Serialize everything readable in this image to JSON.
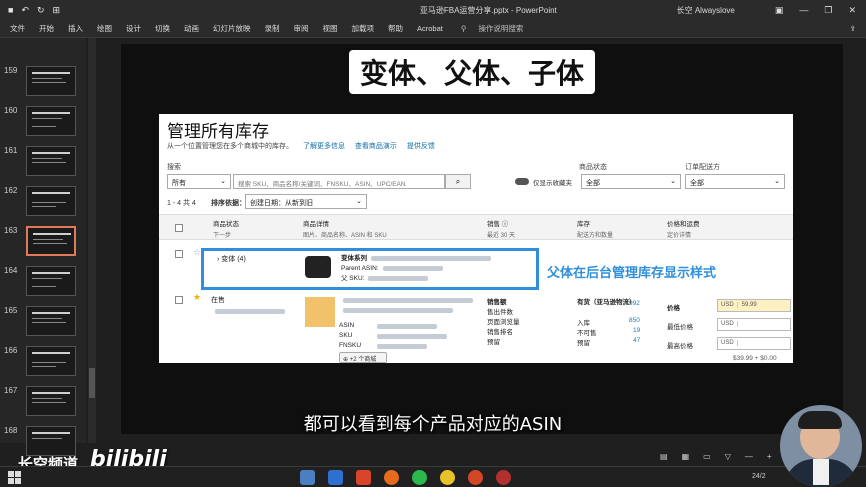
{
  "app": {
    "quick_access": [
      "■",
      "↶",
      "↻",
      "⊞"
    ],
    "window_title": "亚马逊FBA运营分享.pptx - PowerPoint",
    "user": "长空 Alwayslove",
    "window_controls": [
      "▣",
      "—",
      "❐",
      "✕"
    ]
  },
  "menu": {
    "items": [
      "文件",
      "开始",
      "插入",
      "绘图",
      "设计",
      "切换",
      "动画",
      "幻灯片放映",
      "录制",
      "审阅",
      "视图",
      "加载项",
      "帮助",
      "Acrobat"
    ],
    "tell_me": "操作说明搜索",
    "share_icon": "⇪"
  },
  "thumbnails": [
    {
      "num": "159",
      "selected": false
    },
    {
      "num": "160",
      "selected": false
    },
    {
      "num": "161",
      "selected": false
    },
    {
      "num": "162",
      "selected": false
    },
    {
      "num": "163",
      "selected": true
    },
    {
      "num": "164",
      "selected": false
    },
    {
      "num": "165",
      "selected": false
    },
    {
      "num": "166",
      "selected": false
    },
    {
      "num": "167",
      "selected": false
    },
    {
      "num": "168",
      "selected": false
    }
  ],
  "slide": {
    "title": "变体、父体、子体",
    "annotation": "父体在后台管理库存显示样式"
  },
  "inventory": {
    "title": "管理所有库存",
    "subtitle": "从一个位置管理您在多个商城中的库存。",
    "links": [
      "了解更多信息",
      "查看商品演示",
      "提供反馈"
    ],
    "search_label": "搜索",
    "search_scope": "所有",
    "search_placeholder": "搜索 SKU、商品名称/关键词、FNSKU、ASIN、UPC/EAN",
    "search_btn": "⌕",
    "toggle_label": "仅显示收藏夹",
    "status_label": "商品状态",
    "status_value": "全部",
    "fulfill_label": "订单配送方",
    "fulfill_value": "全部",
    "count": "1 - 4 共 4",
    "sort_label": "排序依据：",
    "sort_value": "创建日期：从新到旧",
    "columns": [
      {
        "main": "商品状态",
        "sub": "下一步"
      },
      {
        "main": "商品详情",
        "sub": "图片、商品名称、ASIN 和 SKU"
      },
      {
        "main": "销售 ⓘ",
        "sub": "最近 30 天"
      },
      {
        "main": "库存",
        "sub": "配送方和数量"
      },
      {
        "main": "价格和运费",
        "sub": "定价详情"
      }
    ],
    "parent_row": {
      "variation": "变体 (4)",
      "series": "变体系列",
      "parent_asin": "Parent ASIN:",
      "parent_sku": "父 SKU:"
    },
    "child_row": {
      "status": "在售",
      "fields": [
        "ASIN",
        "SKU",
        "FNSKU"
      ],
      "sales_head": "销售额",
      "sales_rows": [
        "售出件数",
        "页面浏览量",
        "销售排名",
        "预留"
      ],
      "inv_head": "有货（亚马逊物流）",
      "inv_rows": [
        {
          "label": "入库",
          "value": "850"
        },
        {
          "label": "不可售",
          "value": "19"
        },
        {
          "label": "预留",
          "value": "47"
        }
      ],
      "available": "992",
      "price_head": "价格",
      "price_rows": [
        "最低价格",
        "最高价格"
      ],
      "currency": "USD",
      "price": "59.99",
      "more_sites": "+2 个商城",
      "price_note": "$39.99 + $0.00"
    }
  },
  "subtitle": "都可以看到每个产品对应的ASIN",
  "watermark": "长空频道",
  "bili_logo": "bilibili",
  "statusbar_icons": [
    "▤",
    "▦",
    "▭",
    "▽",
    "—",
    "+"
  ],
  "tray_time": "24/2"
}
